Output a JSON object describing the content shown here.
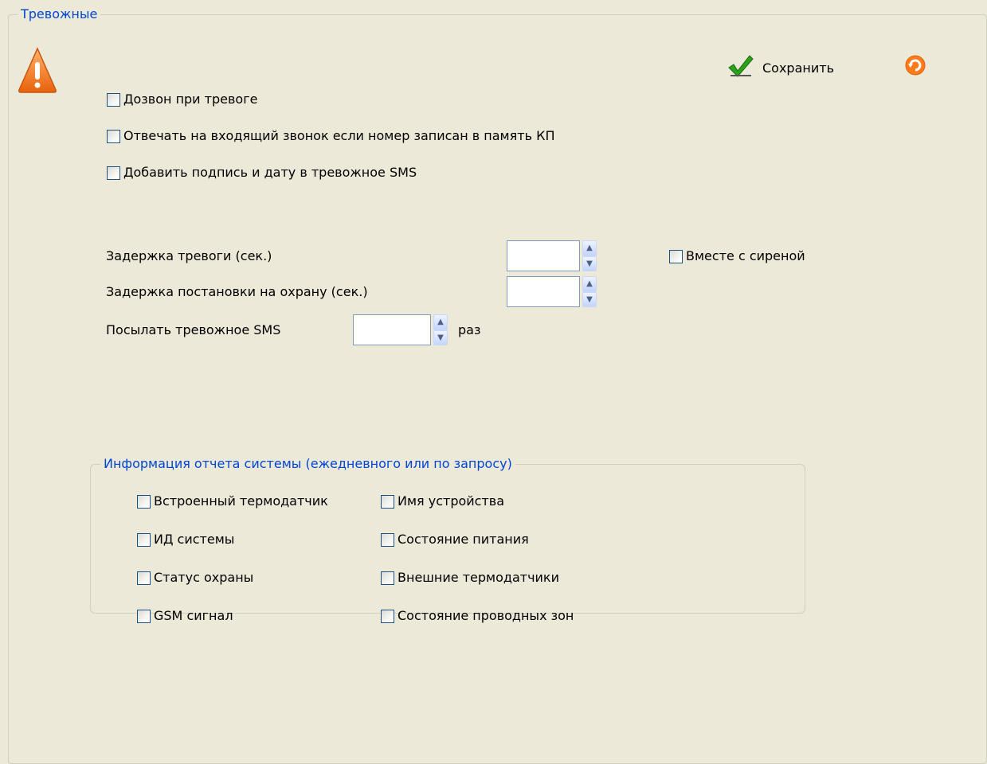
{
  "group": {
    "title": "Тревожные"
  },
  "toolbar": {
    "save_label": "Сохранить"
  },
  "checkboxes": {
    "dial_on_alarm": {
      "label": "Дозвон при тревоге",
      "checked": false
    },
    "answer_incoming": {
      "label": "Отвечать на входящий звонок если номер записан в память КП",
      "checked": false
    },
    "add_signature": {
      "label": "Добавить подпись и дату в тревожное SMS",
      "checked": false
    },
    "with_siren": {
      "label": "Вместе с сиреной",
      "checked": false
    }
  },
  "fields": {
    "alarm_delay": {
      "label": "Задержка тревоги (сек.)",
      "value": ""
    },
    "arming_delay": {
      "label": "Задержка постановки на охрану (сек.)",
      "value": ""
    },
    "sms_count": {
      "label": "Посылать тревожное SMS",
      "value": "",
      "suffix": "раз"
    }
  },
  "report": {
    "title": "Информация отчета системы (ежедневного или по запросу)",
    "left": [
      {
        "label": "Встроенный термодатчик"
      },
      {
        "label": "ИД системы"
      },
      {
        "label": "Статус охраны"
      },
      {
        "label": "GSM сигнал"
      }
    ],
    "right": [
      {
        "label": "Имя устройства"
      },
      {
        "label": "Состояние питания"
      },
      {
        "label": "Внешние термодатчики"
      },
      {
        "label": "Состояние проводных зон"
      }
    ]
  },
  "icons": {
    "warning": "warning-icon",
    "save": "checkmark-icon",
    "refresh": "refresh-icon"
  }
}
